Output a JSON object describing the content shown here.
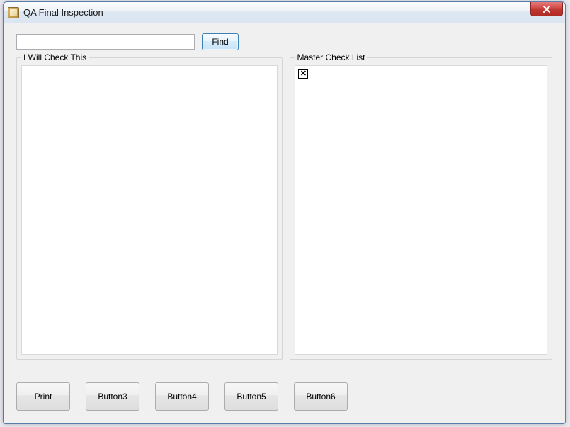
{
  "window": {
    "title": "QA Final Inspection"
  },
  "search": {
    "value": "",
    "placeholder": ""
  },
  "buttons": {
    "find": "Find",
    "print": "Print",
    "b3": "Button3",
    "b4": "Button4",
    "b5": "Button5",
    "b6": "Button6"
  },
  "panels": {
    "left_title": "I Will Check This",
    "right_title": "Master Check List"
  }
}
